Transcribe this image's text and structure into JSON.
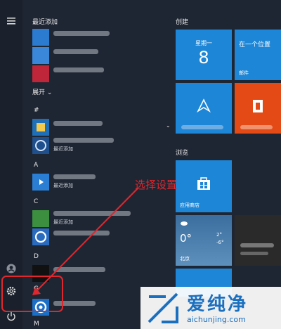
{
  "sidebar": {
    "icons": [
      "hamburger-icon",
      "user-icon",
      "settings-gear-icon",
      "power-icon"
    ]
  },
  "list": {
    "recent_header": "最近添加",
    "expand_label": "展开",
    "letters": [
      "#",
      "A",
      "C",
      "D",
      "G",
      "M"
    ],
    "recent_tag": "最近添加"
  },
  "tiles": {
    "create_header": "创建",
    "browse_header": "浏览",
    "calendar": {
      "weekday": "星期一",
      "day": "8"
    },
    "mail": {
      "title": "在一个位置",
      "label": "邮件"
    },
    "store": {
      "label": "应用商店"
    },
    "weather": {
      "temp": "0°",
      "high": "2°",
      "low": "-6°",
      "city": "北京"
    }
  },
  "annotation": {
    "text": "选择设置",
    "color": "#e0272e"
  },
  "watermark": {
    "brand": "爱纯净",
    "url": "aichunjing.com"
  },
  "colors": {
    "tile_blue": "#1e86d6",
    "office_orange": "#e34a16",
    "edge_blue": "#1b6fc6",
    "store_blue": "#1e86d6",
    "annotation_red": "#e0272e"
  }
}
